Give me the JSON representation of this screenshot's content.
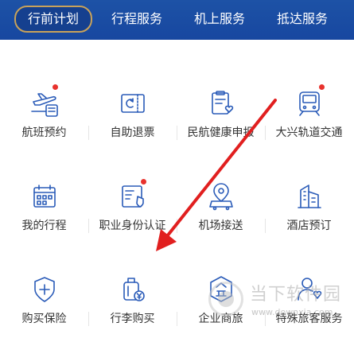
{
  "tabs": [
    {
      "label": "行前计划",
      "active": true
    },
    {
      "label": "行程服务",
      "active": false
    },
    {
      "label": "机上服务",
      "active": false
    },
    {
      "label": "抵达服务",
      "active": false
    }
  ],
  "services": [
    {
      "label": "航班预约",
      "icon": "plane-booking-icon",
      "badge": true
    },
    {
      "label": "自助退票",
      "icon": "ticket-refund-icon",
      "badge": false
    },
    {
      "label": "民航健康申报",
      "icon": "health-declaration-icon",
      "badge": false
    },
    {
      "label": "大兴轨道交通",
      "icon": "rail-transit-icon",
      "badge": true
    },
    {
      "label": "我的行程",
      "icon": "calendar-icon",
      "badge": false
    },
    {
      "label": "职业身份认证",
      "icon": "id-badge-icon",
      "badge": true
    },
    {
      "label": "机场接送",
      "icon": "location-car-icon",
      "badge": false
    },
    {
      "label": "酒店预订",
      "icon": "hotel-building-icon",
      "badge": false
    },
    {
      "label": "购买保险",
      "icon": "shield-plus-icon",
      "badge": false
    },
    {
      "label": "行李购买",
      "icon": "luggage-yen-icon",
      "badge": false
    },
    {
      "label": "企业商旅",
      "icon": "enterprise-icon",
      "badge": false
    },
    {
      "label": "特殊旅客服务",
      "icon": "special-passenger-icon",
      "badge": false
    }
  ],
  "colors": {
    "header_bg": "#1a4ca3",
    "tab_border": "#c8a25a",
    "icon_blue": "#2a5bb8",
    "badge_red": "#e8322d",
    "arrow_red": "#e11f1f"
  },
  "watermark": {
    "title": "当下软件园",
    "url": "www.downxia.com"
  }
}
